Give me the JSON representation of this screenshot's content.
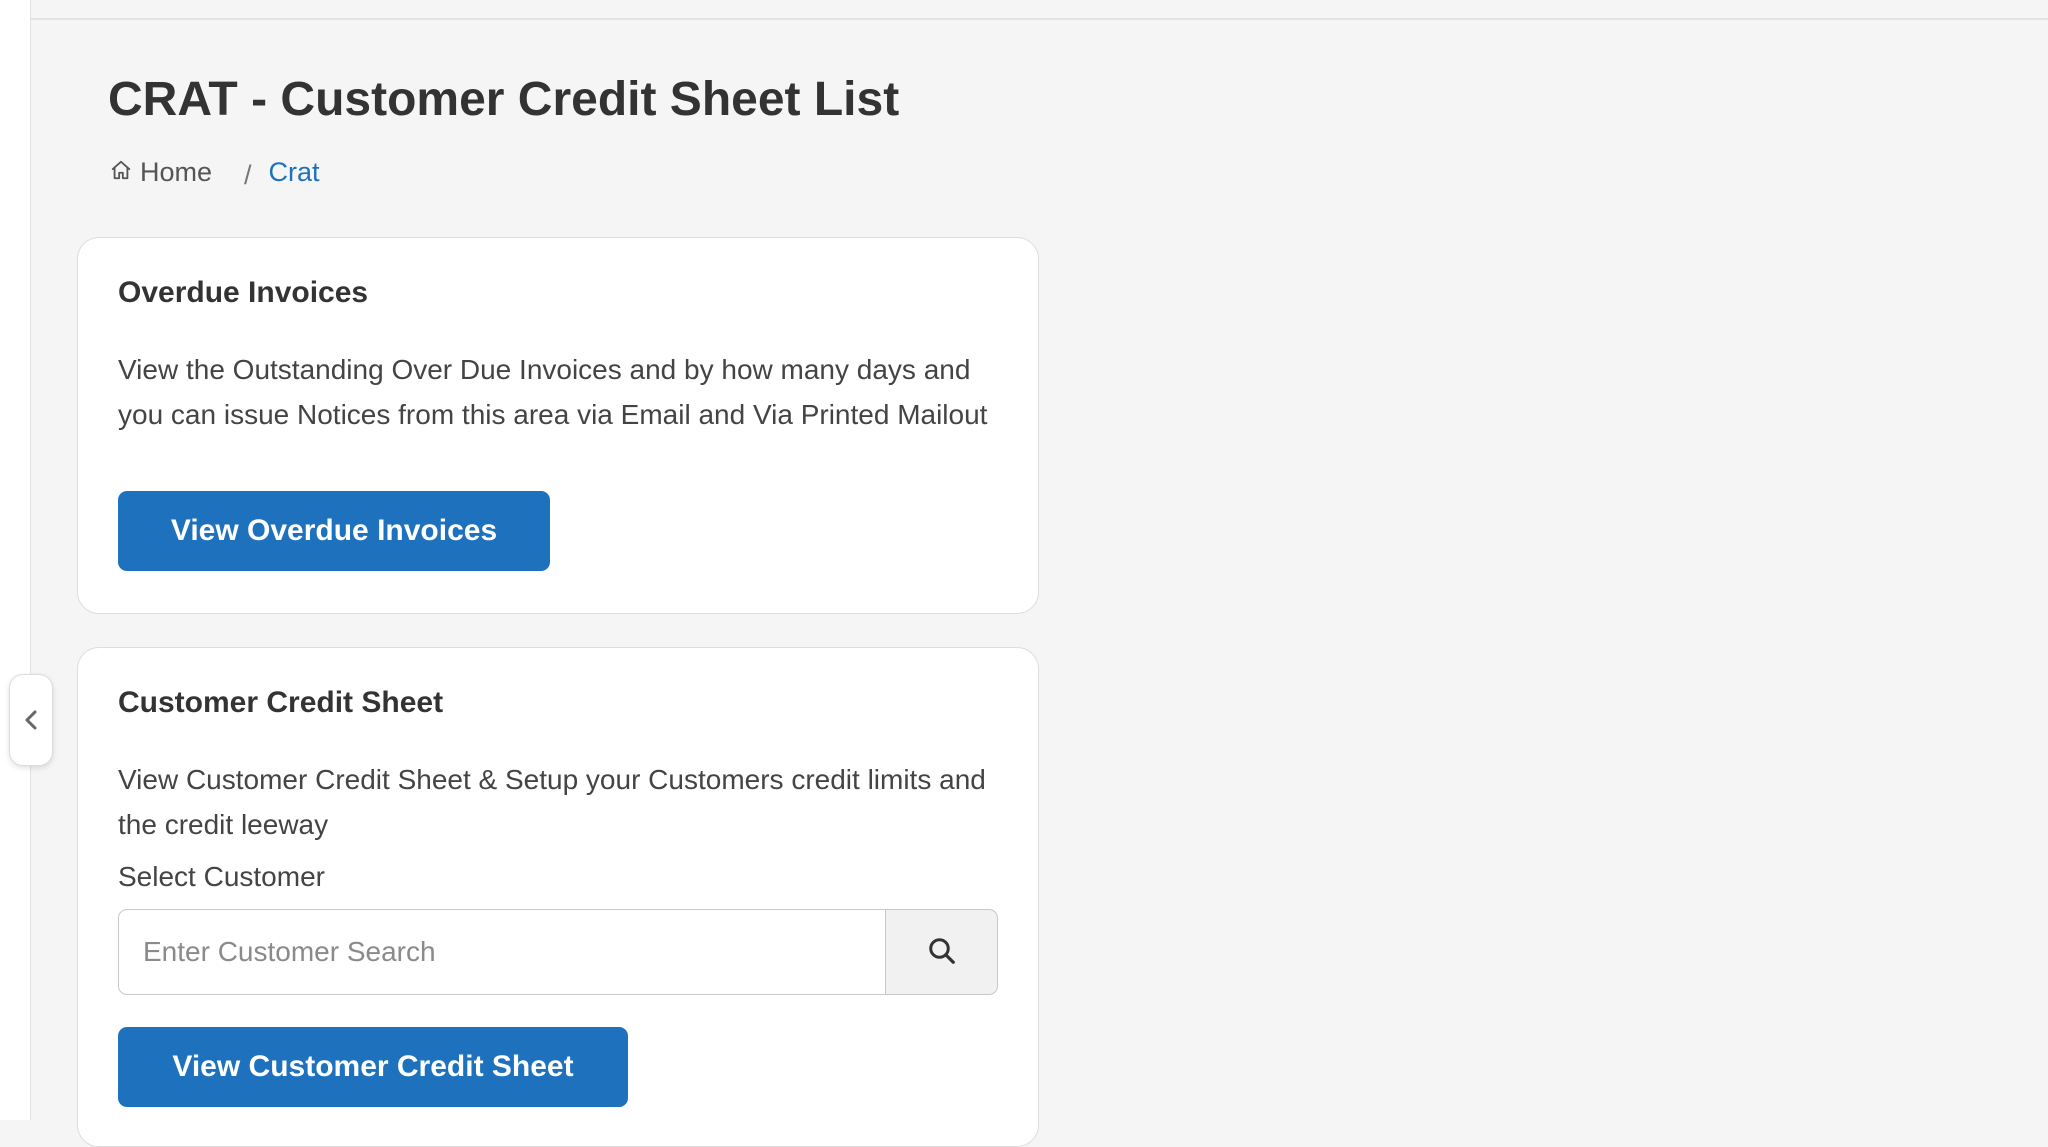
{
  "page": {
    "title": "CRAT - Customer Credit Sheet List"
  },
  "breadcrumb": {
    "home_label": "Home",
    "separator": "/",
    "current_label": "Crat"
  },
  "overdue_card": {
    "title": "Overdue Invoices",
    "description": "View the Outstanding Over Due Invoices and by how many days and you can issue Notices from this area via Email and Via Printed Mailout",
    "button_label": "View Overdue Invoices"
  },
  "credit_card": {
    "title": "Customer Credit Sheet",
    "description": "View Customer Credit Sheet & Setup your Customers credit limits and the credit leeway",
    "select_label": "Select Customer",
    "search_placeholder": "Enter Customer Search",
    "search_value": "",
    "button_label": "View Customer Credit Sheet"
  },
  "icons": {
    "home": "home-icon",
    "search": "search-icon",
    "collapse": "chevron-left-icon"
  },
  "colors": {
    "primary": "#1e72bd",
    "background": "#f5f5f5",
    "card": "#ffffff",
    "text": "#333333"
  }
}
